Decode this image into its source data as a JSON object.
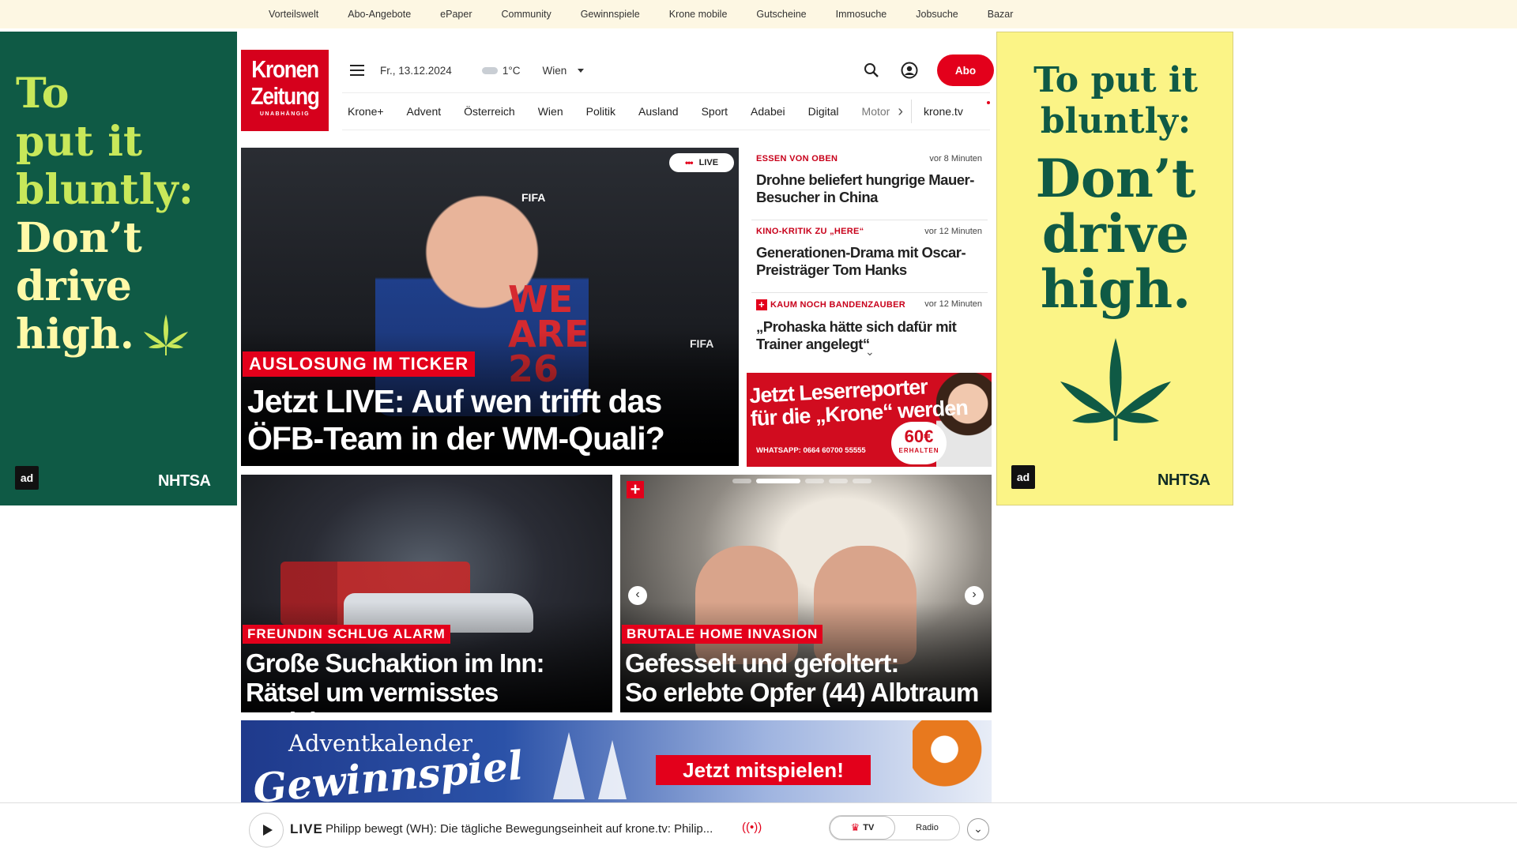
{
  "topbar": {
    "links": [
      "Vorteilswelt",
      "Abo-Angebote",
      "ePaper",
      "Community",
      "Gewinnspiele",
      "Krone mobile",
      "Gutscheine",
      "Immosuche",
      "Jobsuche",
      "Bazar"
    ]
  },
  "ad_left": {
    "line1": "To",
    "line2": "put it",
    "line3": "bluntly:",
    "line4": "Don’t",
    "line5": "drive",
    "line6": "high.",
    "logo1": "ad",
    "logo2": "NHTSA",
    "bg_color": "#0f5a45"
  },
  "ad_right": {
    "line1": "To put it",
    "line2": "bluntly:",
    "line3": "Don’t",
    "line4": "drive",
    "line5": "high.",
    "logo1": "ad",
    "logo2": "NHTSA",
    "bg_color": "#fbf486"
  },
  "header": {
    "logo_line1": "Kronen",
    "logo_line2": "Zeitung",
    "logo_line3": "UNABHÄNGIG",
    "date": "Fr., 13.12.2024",
    "temperature": "1°C",
    "city": "Wien",
    "abo_label": "Abo",
    "accent": "#e3001b"
  },
  "nav": {
    "items": [
      "Krone+",
      "Advent",
      "Österreich",
      "Wien",
      "Politik",
      "Ausland",
      "Sport",
      "Adabei",
      "Digital",
      "Motor"
    ],
    "tv": "krone.tv"
  },
  "hero": {
    "live_label": "LIVE",
    "kicker": "AUSLOSUNG IM TICKER",
    "headline": "Jetzt LIVE: Auf wen trifft das ÖFB-Team in der WM-Quali?",
    "we_text": "WE ARE 26",
    "fifa": "FIFA"
  },
  "news": [
    {
      "tag": "ESSEN VON OBEN",
      "time": "vor 8 Minuten",
      "title": "Drohne beliefert hungrige Mauer-Besucher in China",
      "plus": false
    },
    {
      "tag": "KINO-KRITIK ZU „HERE“",
      "time": "vor 12 Minuten",
      "title": "Generationen-Drama mit Oscar-Preisträger Tom Hanks",
      "plus": false
    },
    {
      "tag": "KAUM NOCH BANDENZAUBER",
      "time": "vor 12 Minuten",
      "title": "„Prohaska hätte sich dafür mit Trainer angelegt“",
      "plus": true
    }
  ],
  "reporter_ad": {
    "line1": "Jetzt Leserreporter",
    "line2": "für die „Krone“ werden",
    "whatsapp": "WHATSAPP: 0664 60700 55555",
    "amount": "60€",
    "amount_sub": "ERHALTEN"
  },
  "cards": [
    {
      "kicker": "FREUNDIN SCHLUG ALARM",
      "title_line1": "Große Suchaktion im Inn:",
      "title_line2": "Rätsel um vermisstes Mädchen"
    },
    {
      "kicker": "BRUTALE HOME INVASION",
      "title_line1": "Gefesselt und gefoltert:",
      "title_line2": "So erlebte Opfer (44) Albtraum"
    }
  ],
  "advent": {
    "line1": "Adventkalender",
    "line2": "Gewinnspiel",
    "button": "Jetzt mitspielen!"
  },
  "player": {
    "live": "LIVE",
    "title": "Philipp bewegt (WH): Die tägliche Bewegungseinheit auf krone.tv: Philip...",
    "tv": "TV",
    "radio": "Radio"
  }
}
